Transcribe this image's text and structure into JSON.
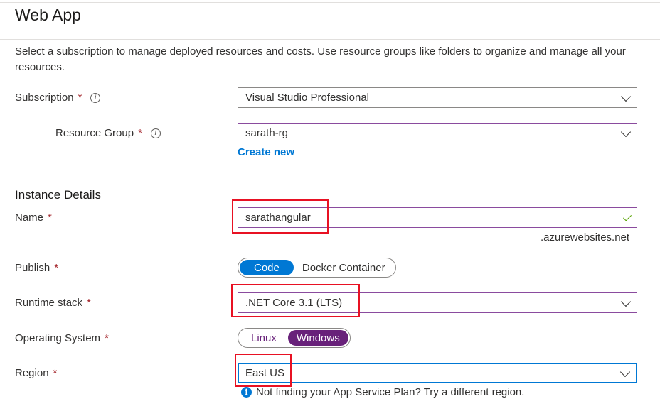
{
  "header": {
    "title": "Web App"
  },
  "description": "Select a subscription to manage deployed resources and costs. Use resource groups like folders to organize and manage all your resources.",
  "required_marker": "*",
  "subscription": {
    "label": "Subscription",
    "value": "Visual Studio Professional",
    "info_icon": "info-icon"
  },
  "resource_group": {
    "label": "Resource Group",
    "value": "sarath-rg",
    "create_new": "Create new"
  },
  "instance_details": {
    "heading": "Instance Details",
    "name": {
      "label": "Name",
      "value": "sarathangular",
      "suffix": ".azurewebsites.net",
      "valid_icon": "check-icon"
    },
    "publish": {
      "label": "Publish",
      "options": [
        "Code",
        "Docker Container"
      ],
      "selected": "Code"
    },
    "runtime_stack": {
      "label": "Runtime stack",
      "value": ".NET Core 3.1 (LTS)"
    },
    "operating_system": {
      "label": "Operating System",
      "options": [
        "Linux",
        "Windows"
      ],
      "selected": "Windows"
    },
    "region": {
      "label": "Region",
      "value": "East US",
      "hint": "Not finding your App Service Plan? Try a different region."
    }
  },
  "colors": {
    "accent": "#0078d4",
    "required": "#a4262c",
    "windows_selected": "#68217a",
    "highlight_box": "#e81123",
    "valid": "#57a300"
  }
}
